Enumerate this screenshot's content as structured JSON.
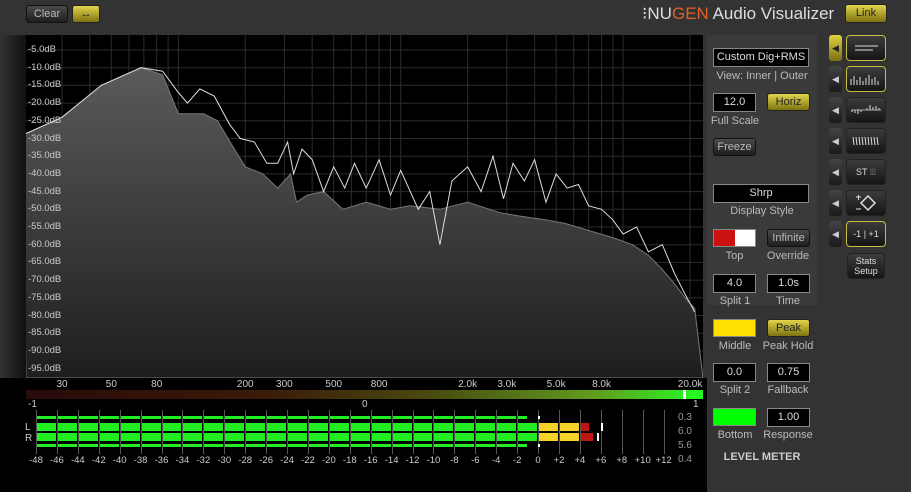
{
  "toolbar": {
    "clear": "Clear",
    "swap_icon": "↔",
    "link": "Link"
  },
  "brand": {
    "prefix": "NU",
    "accent": "GEN",
    "suffix": " Audio Visualizer"
  },
  "spectrum": {
    "y_labels": [
      "-5.0dB",
      "-10.0dB",
      "-15.0dB",
      "-20.0dB",
      "-25.0dB",
      "-30.0dB",
      "-35.0dB",
      "-40.0dB",
      "-45.0dB",
      "-50.0dB",
      "-55.0dB",
      "-60.0dB",
      "-65.0dB",
      "-70.0dB",
      "-75.0dB",
      "-80.0dB",
      "-85.0dB",
      "-90.0dB",
      "-95.0dB"
    ],
    "x_labels": [
      {
        "f": 30,
        "t": "30"
      },
      {
        "f": 50,
        "t": "50"
      },
      {
        "f": 80,
        "t": "80"
      },
      {
        "f": 200,
        "t": "200"
      },
      {
        "f": 300,
        "t": "300"
      },
      {
        "f": 500,
        "t": "500"
      },
      {
        "f": 800,
        "t": "800"
      },
      {
        "f": 2000,
        "t": "2.0k"
      },
      {
        "f": 3000,
        "t": "3.0k"
      },
      {
        "f": 5000,
        "t": "5.0k"
      },
      {
        "f": 8000,
        "t": "8.0k"
      },
      {
        "f": 20000,
        "t": "20.0k"
      }
    ],
    "rms": [
      [
        20,
        -29
      ],
      [
        30,
        -24
      ],
      [
        45,
        -15
      ],
      [
        68,
        -10
      ],
      [
        85,
        -12
      ],
      [
        100,
        -23
      ],
      [
        130,
        -23
      ],
      [
        150,
        -25
      ],
      [
        175,
        -32
      ],
      [
        200,
        -38
      ],
      [
        240,
        -40
      ],
      [
        280,
        -44
      ],
      [
        320,
        -40
      ],
      [
        340,
        -48
      ],
      [
        380,
        -46
      ],
      [
        450,
        -45
      ],
      [
        550,
        -50
      ],
      [
        700,
        -48
      ],
      [
        900,
        -50
      ],
      [
        1100,
        -49
      ],
      [
        1500,
        -50
      ],
      [
        2000,
        -48
      ],
      [
        2800,
        -51
      ],
      [
        3500,
        -52
      ],
      [
        4500,
        -53
      ],
      [
        5500,
        -54
      ],
      [
        7000,
        -56
      ],
      [
        9000,
        -58
      ],
      [
        11000,
        -60
      ],
      [
        13000,
        -63
      ],
      [
        15000,
        -67
      ],
      [
        17000,
        -71
      ],
      [
        19000,
        -75
      ],
      [
        21000,
        -78
      ]
    ],
    "peak": [
      [
        20,
        -29
      ],
      [
        30,
        -24
      ],
      [
        45,
        -15
      ],
      [
        68,
        -10
      ],
      [
        85,
        -11
      ],
      [
        100,
        -17
      ],
      [
        110,
        -20
      ],
      [
        125,
        -16
      ],
      [
        145,
        -18
      ],
      [
        170,
        -26
      ],
      [
        190,
        -30
      ],
      [
        220,
        -31
      ],
      [
        250,
        -37
      ],
      [
        280,
        -37
      ],
      [
        310,
        -31
      ],
      [
        330,
        -40
      ],
      [
        360,
        -33
      ],
      [
        400,
        -36
      ],
      [
        450,
        -45
      ],
      [
        500,
        -38
      ],
      [
        560,
        -44
      ],
      [
        620,
        -37
      ],
      [
        700,
        -44
      ],
      [
        800,
        -36
      ],
      [
        900,
        -46
      ],
      [
        1000,
        -39
      ],
      [
        1200,
        -50
      ],
      [
        1350,
        -45
      ],
      [
        1500,
        -60
      ],
      [
        1700,
        -42
      ],
      [
        2000,
        -38
      ],
      [
        2300,
        -45
      ],
      [
        2600,
        -35
      ],
      [
        2900,
        -47
      ],
      [
        3200,
        -37
      ],
      [
        3600,
        -42
      ],
      [
        4000,
        -36
      ],
      [
        4500,
        -48
      ],
      [
        5000,
        -40
      ],
      [
        5600,
        -44
      ],
      [
        6300,
        -43
      ],
      [
        7000,
        -49
      ],
      [
        8000,
        -50
      ],
      [
        9000,
        -53
      ],
      [
        10000,
        -57
      ],
      [
        11500,
        -55
      ],
      [
        13000,
        -62
      ],
      [
        15000,
        -60
      ],
      [
        17000,
        -68
      ],
      [
        19000,
        -74
      ],
      [
        21000,
        -79
      ]
    ]
  },
  "correlation": {
    "min": "-1",
    "mid": "0",
    "max": "1",
    "value": 0.95
  },
  "meter": {
    "labels": [
      "-48",
      "-46",
      "-44",
      "-42",
      "-40",
      "-38",
      "-36",
      "-34",
      "-32",
      "-30",
      "-28",
      "-26",
      "-24",
      "-22",
      "-20",
      "-18",
      "-16",
      "-14",
      "-12",
      "-10",
      "-8",
      "-6",
      "-4",
      "-2",
      "0",
      "+2",
      "+4",
      "+6",
      "+8",
      "+10",
      "+12"
    ],
    "channel_left": "L",
    "channel_right": "R",
    "left_db": 5.0,
    "right_db": 5.3,
    "left_rms_db": -1,
    "right_rms_db": -1,
    "left_hold_db": 6.0,
    "right_hold_db": 5.6,
    "readouts": [
      "0.3",
      "6.0",
      "5.6",
      "0.4"
    ]
  },
  "panel": {
    "preset": "Custom Dig+RMS",
    "view": "View: Inner | Outer",
    "full_scale_value": "12.0",
    "full_scale": "Full Scale",
    "horiz": "Horiz",
    "freeze": "Freeze",
    "display_style_value": "Shrp",
    "display_style": "Display Style",
    "infinite": "Infinite",
    "top": "Top",
    "override": "Override",
    "split1_value": "4.0",
    "split1": "Split 1",
    "time_value": "1.0s",
    "time": "Time",
    "middle": "Middle",
    "peak": "Peak",
    "peak_hold": "Peak Hold",
    "split2_value": "0.0",
    "split2": "Split 2",
    "fallback_value": "0.75",
    "fallback": "Fallback",
    "bottom": "Bottom",
    "response_value": "1.00",
    "response": "Response",
    "title": "LEVEL METER",
    "colors": {
      "top_a": "#cc1111",
      "top_b": "#ffffff",
      "middle": "#ffe000",
      "bottom": "#00ff00"
    }
  },
  "side": {
    "st": "ST",
    "stats": "Stats Setup",
    "minus_one": "-1",
    "plus_one": "+1"
  }
}
